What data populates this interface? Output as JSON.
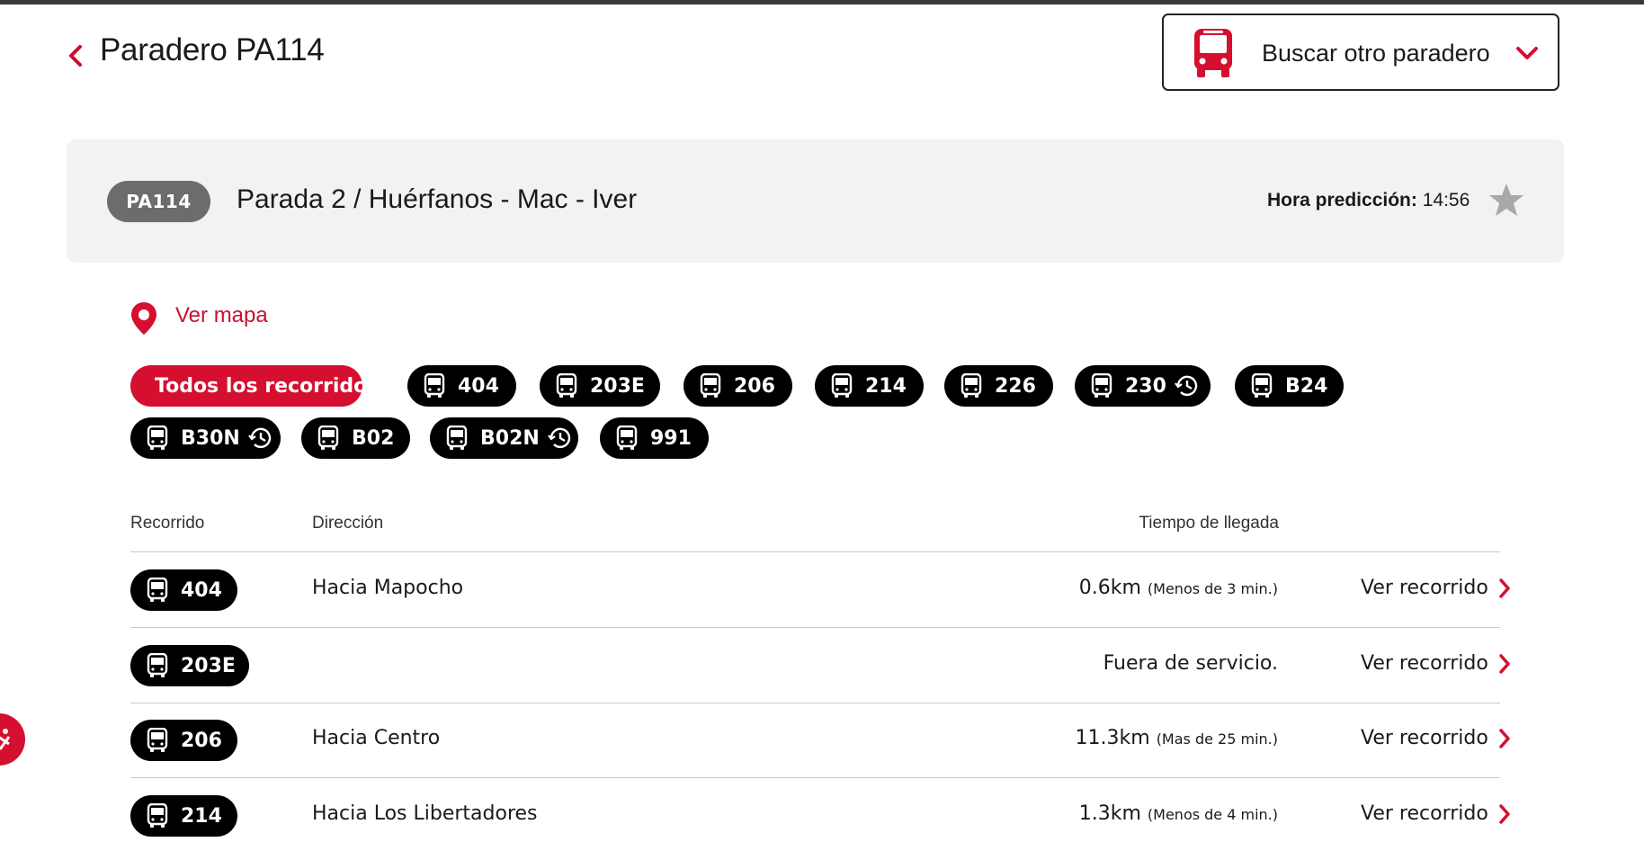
{
  "header": {
    "title": "Paradero PA114",
    "search_label": "Buscar otro paradero"
  },
  "stop": {
    "code": "PA114",
    "name": "Parada 2 / Huérfanos - Mac - Iver",
    "prediction_label": "Hora predicción:",
    "prediction_time": "14:56"
  },
  "map_link": "Ver mapa",
  "filters": {
    "all_label": "Todos los recorridos",
    "routes": [
      {
        "label": "404",
        "schedule": false
      },
      {
        "label": "203E",
        "schedule": false
      },
      {
        "label": "206",
        "schedule": false
      },
      {
        "label": "214",
        "schedule": false
      },
      {
        "label": "226",
        "schedule": false
      },
      {
        "label": "230",
        "schedule": true
      },
      {
        "label": "B24",
        "schedule": false
      },
      {
        "label": "B30N",
        "schedule": true
      },
      {
        "label": "B02",
        "schedule": false
      },
      {
        "label": "B02N",
        "schedule": true
      },
      {
        "label": "991",
        "schedule": false
      }
    ]
  },
  "table": {
    "headers": {
      "route": "Recorrido",
      "direction": "Dirección",
      "arrival": "Tiempo de llegada"
    },
    "rows": [
      {
        "route": "404",
        "direction": "Hacia Mapocho",
        "distance": "0.6km",
        "note": "(Menos de 3 min.)",
        "link": "Ver recorrido"
      },
      {
        "route": "203E",
        "direction": "",
        "distance": "Fuera de servicio.",
        "note": "",
        "link": "Ver recorrido"
      },
      {
        "route": "206",
        "direction": "Hacia Centro",
        "distance": "11.3km",
        "note": "(Mas de 25 min.)",
        "link": "Ver recorrido"
      },
      {
        "route": "214",
        "direction": "Hacia Los Libertadores",
        "distance": "1.3km",
        "note": "(Menos de 4 min.)",
        "link": "Ver recorrido"
      }
    ]
  },
  "icons": {
    "back": "chevron-left-icon",
    "bus": "bus-icon",
    "dropdown": "chevron-down-icon",
    "favorite": "star-icon",
    "map": "map-pin-icon",
    "schedule": "clock-history-icon",
    "accessibility": "accessibility-icon"
  },
  "colors": {
    "accent": "#d50f2f",
    "chip": "#000000",
    "stop_code": "#6b6c6c",
    "card": "#f1f2f2"
  }
}
